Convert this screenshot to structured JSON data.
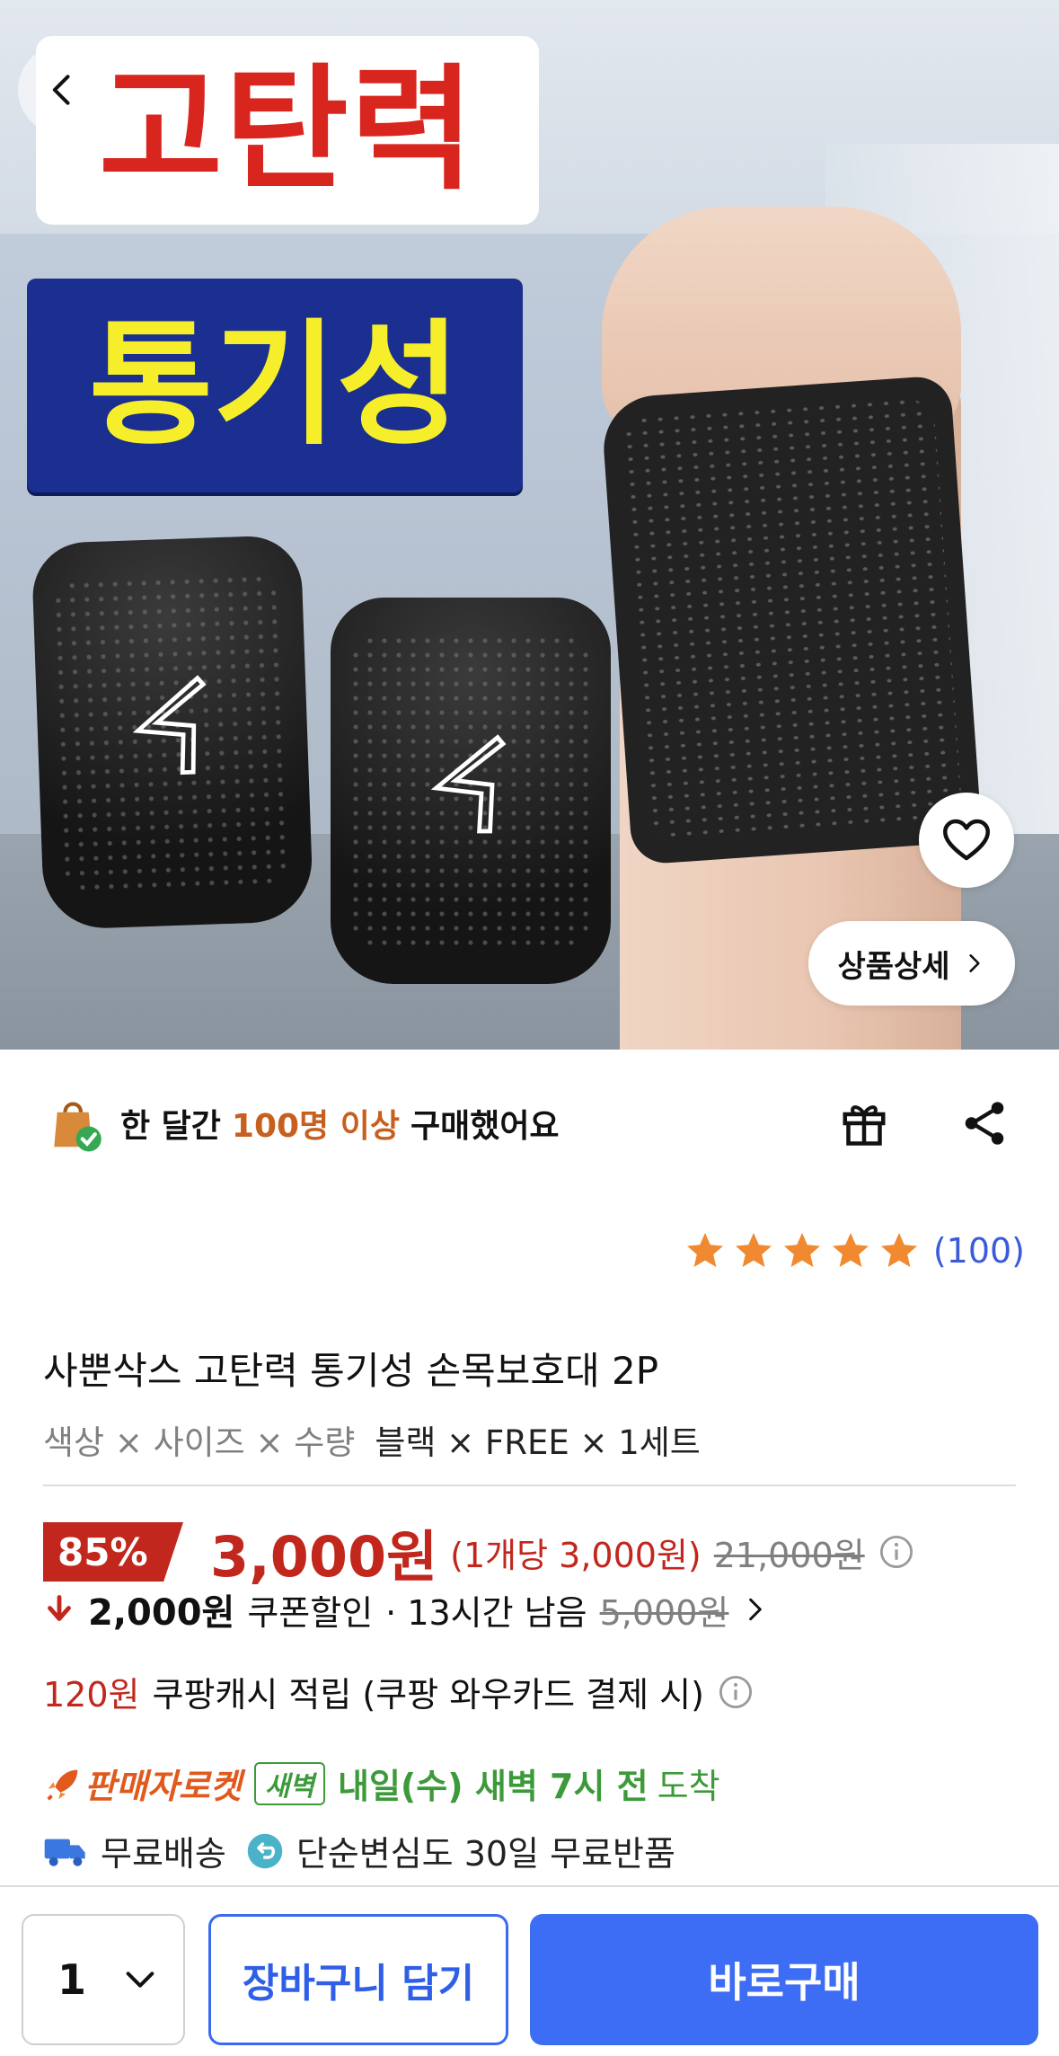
{
  "hero": {
    "headline1": "고탄력",
    "headline2": "통기성",
    "detail_button": "상품상세",
    "icons": {
      "back": "chevron-left-icon",
      "wishlist": "heart-icon",
      "detail": "chevron-right-icon"
    }
  },
  "social_proof": {
    "prefix": "한 달간",
    "highlight": "100명 이상",
    "suffix": "구매했어요",
    "icons": {
      "bag": "shopping-bag-check-icon",
      "gift": "gift-icon",
      "share": "share-icon"
    }
  },
  "rating": {
    "stars": 5,
    "count": "(100)"
  },
  "product": {
    "title": "사뿐삭스 고탄력 통기성 손목보호대 2P",
    "option_label": "색상 × 사이즈 × 수량",
    "option_value": "블랙 × FREE × 1세트"
  },
  "price": {
    "discount": "85%",
    "sale": "3,000원",
    "per_unit": "(1개당 3,000원)",
    "original": "21,000원"
  },
  "coupon": {
    "amount": "2,000원",
    "label": "쿠폰할인",
    "time_left": "· 13시간 남음",
    "original": "5,000원"
  },
  "cashback": {
    "amount": "120원",
    "text": "쿠팡캐시 적립 (쿠팡 와우카드 결제 시)"
  },
  "delivery": {
    "seller_rocket": "판매자로켓",
    "dawn_badge": "새벽",
    "arrival": "내일(수) 새벽 7시 전",
    "arrival_suffix": "도착",
    "free_shipping": "무료배송",
    "returns": "단순변심도 30일 무료반품"
  },
  "bottom_bar": {
    "quantity": "1",
    "cart_button": "장바구니 담기",
    "buy_button": "바로구매"
  },
  "colors": {
    "accent_red": "#c1271d",
    "accent_blue": "#3d6df5",
    "star_orange": "#f0892f",
    "green": "#3d9a3a"
  }
}
